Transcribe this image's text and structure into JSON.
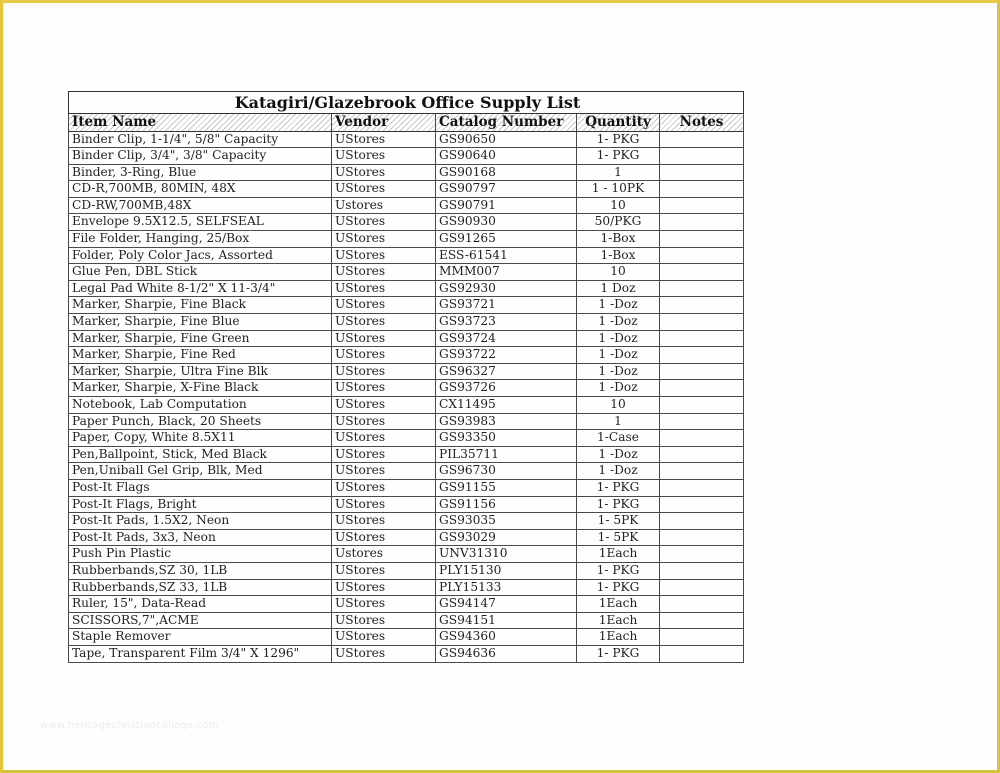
{
  "document": {
    "title": "Katagiri/Glazebrook Office Supply List",
    "watermark": "www.heritagechristiancollege.com",
    "columns": [
      "Item Name",
      "Vendor",
      "Catalog Number",
      "Quantity",
      "Notes"
    ],
    "rows": [
      {
        "item": "Binder Clip, 1-1/4\", 5/8\" Capacity",
        "vendor": "UStores",
        "catalog": "GS90650",
        "quantity": "1- PKG",
        "notes": ""
      },
      {
        "item": "Binder Clip, 3/4\", 3/8\" Capacity",
        "vendor": "UStores",
        "catalog": "GS90640",
        "quantity": "1- PKG",
        "notes": ""
      },
      {
        "item": "Binder, 3-Ring, Blue",
        "vendor": "UStores",
        "catalog": "GS90168",
        "quantity": "1",
        "notes": ""
      },
      {
        "item": "CD-R,700MB, 80MIN, 48X",
        "vendor": "UStores",
        "catalog": "GS90797",
        "quantity": "1 - 10PK",
        "notes": ""
      },
      {
        "item": "CD-RW,700MB,48X",
        "vendor": "Ustores",
        "catalog": "GS90791",
        "quantity": "10",
        "notes": ""
      },
      {
        "item": "Envelope 9.5X12.5, SELFSEAL",
        "vendor": "UStores",
        "catalog": "GS90930",
        "quantity": "50/PKG",
        "notes": ""
      },
      {
        "item": "File Folder, Hanging, 25/Box",
        "vendor": "UStores",
        "catalog": "GS91265",
        "quantity": "1-Box",
        "notes": ""
      },
      {
        "item": "Folder, Poly Color Jacs, Assorted",
        "vendor": "UStores",
        "catalog": "ESS-61541",
        "quantity": "1-Box",
        "notes": ""
      },
      {
        "item": "Glue Pen, DBL Stick",
        "vendor": "UStores",
        "catalog": "MMM007",
        "quantity": "10",
        "notes": ""
      },
      {
        "item": "Legal Pad White 8-1/2\" X 11-3/4\"",
        "vendor": "UStores",
        "catalog": "GS92930",
        "quantity": "1 Doz",
        "notes": ""
      },
      {
        "item": "Marker, Sharpie, Fine Black",
        "vendor": "UStores",
        "catalog": "GS93721",
        "quantity": "1 -Doz",
        "notes": ""
      },
      {
        "item": "Marker, Sharpie, Fine Blue",
        "vendor": "UStores",
        "catalog": "GS93723",
        "quantity": "1 -Doz",
        "notes": ""
      },
      {
        "item": "Marker, Sharpie, Fine Green",
        "vendor": "UStores",
        "catalog": "GS93724",
        "quantity": "1 -Doz",
        "notes": ""
      },
      {
        "item": "Marker, Sharpie, Fine Red",
        "vendor": "UStores",
        "catalog": "GS93722",
        "quantity": "1 -Doz",
        "notes": ""
      },
      {
        "item": "Marker, Sharpie, Ultra Fine Blk",
        "vendor": "UStores",
        "catalog": "GS96327",
        "quantity": "1 -Doz",
        "notes": ""
      },
      {
        "item": "Marker, Sharpie, X-Fine Black",
        "vendor": "UStores",
        "catalog": "GS93726",
        "quantity": "1 -Doz",
        "notes": ""
      },
      {
        "item": "Notebook, Lab Computation",
        "vendor": "UStores",
        "catalog": "CX11495",
        "quantity": "10",
        "notes": ""
      },
      {
        "item": "Paper Punch, Black, 20 Sheets",
        "vendor": "UStores",
        "catalog": "GS93983",
        "quantity": "1",
        "notes": ""
      },
      {
        "item": "Paper, Copy, White 8.5X11",
        "vendor": "UStores",
        "catalog": "GS93350",
        "quantity": "1-Case",
        "notes": ""
      },
      {
        "item": "Pen,Ballpoint, Stick, Med Black",
        "vendor": "UStores",
        "catalog": "PIL35711",
        "quantity": "1 -Doz",
        "notes": ""
      },
      {
        "item": "Pen,Uniball Gel Grip, Blk, Med",
        "vendor": "UStores",
        "catalog": "GS96730",
        "quantity": "1 -Doz",
        "notes": ""
      },
      {
        "item": "Post-It Flags",
        "vendor": "UStores",
        "catalog": "GS91155",
        "quantity": "1- PKG",
        "notes": ""
      },
      {
        "item": "Post-It Flags, Bright",
        "vendor": "UStores",
        "catalog": "GS91156",
        "quantity": "1- PKG",
        "notes": ""
      },
      {
        "item": "Post-It Pads, 1.5X2, Neon",
        "vendor": "UStores",
        "catalog": "GS93035",
        "quantity": "1- 5PK",
        "notes": ""
      },
      {
        "item": "Post-It Pads, 3x3, Neon",
        "vendor": "UStores",
        "catalog": "GS93029",
        "quantity": "1- 5PK",
        "notes": ""
      },
      {
        "item": "Push Pin Plastic",
        "vendor": "Ustores",
        "catalog": "UNV31310",
        "quantity": "1Each",
        "notes": ""
      },
      {
        "item": "Rubberbands,SZ 30, 1LB",
        "vendor": "UStores",
        "catalog": "PLY15130",
        "quantity": "1- PKG",
        "notes": ""
      },
      {
        "item": "Rubberbands,SZ 33, 1LB",
        "vendor": "UStores",
        "catalog": "PLY15133",
        "quantity": "1- PKG",
        "notes": ""
      },
      {
        "item": "Ruler, 15\", Data-Read",
        "vendor": "UStores",
        "catalog": "GS94147",
        "quantity": "1Each",
        "notes": ""
      },
      {
        "item": "SCISSORS,7\",ACME",
        "vendor": "UStores",
        "catalog": "GS94151",
        "quantity": "1Each",
        "notes": ""
      },
      {
        "item": "Staple Remover",
        "vendor": "UStores",
        "catalog": "GS94360",
        "quantity": "1Each",
        "notes": ""
      },
      {
        "item": "Tape, Transparent Film 3/4\" X 1296\"",
        "vendor": "UStores",
        "catalog": "GS94636",
        "quantity": "1- PKG",
        "notes": ""
      }
    ]
  }
}
